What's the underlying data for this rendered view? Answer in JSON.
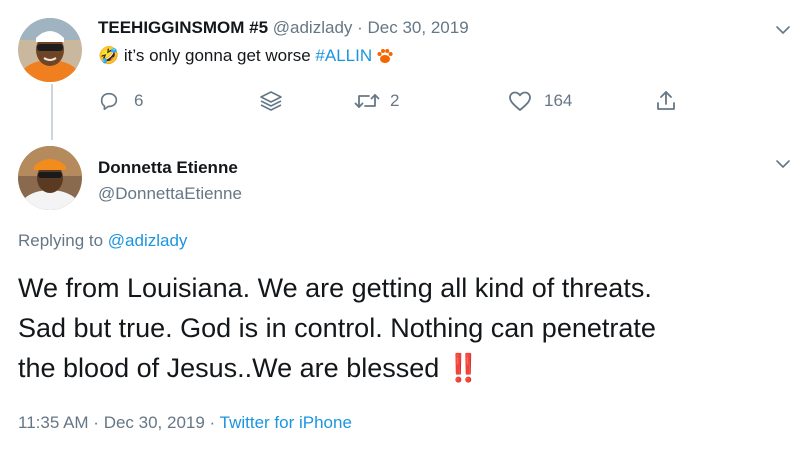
{
  "parent": {
    "display_name": "TEEHIGGINSMOM #5",
    "handle": "@adizlady",
    "separator": " · ",
    "date": "Dec 30, 2019",
    "emoji": "🤣",
    "text": " it’s only gonna get worse ",
    "hashtag": "#ALLIN",
    "reply_count": "6",
    "retweet_count": "2",
    "like_count": "164"
  },
  "reply": {
    "display_name": "Donnetta Etienne",
    "handle": "@DonnettaEtienne",
    "replying_prefix": "Replying to ",
    "replying_handle": "@adizlady",
    "body_line1": "We from Louisiana. We are getting all kind of threats.",
    "body_line2": "Sad but true. God is in control. Nothing can penetrate",
    "body_line3": "the blood of Jesus..We are blessed ",
    "body_emoji": "‼️",
    "time": "11:35 AM",
    "date_sep": " · ",
    "date": "Dec 30, 2019",
    "source_sep": " · ",
    "source": "Twitter for iPhone"
  },
  "colors": {
    "accent": "#1b95e0",
    "text": "#14171a",
    "muted": "#657786",
    "paw": "#f56600",
    "thread_line": "#ccd6dd"
  },
  "icons": {
    "reply": "reply-icon",
    "stack": "stack-icon",
    "retweet": "retweet-icon",
    "like": "heart-icon",
    "share": "share-icon",
    "caret": "chevron-down-icon",
    "paw": "tiger-paw-icon"
  }
}
